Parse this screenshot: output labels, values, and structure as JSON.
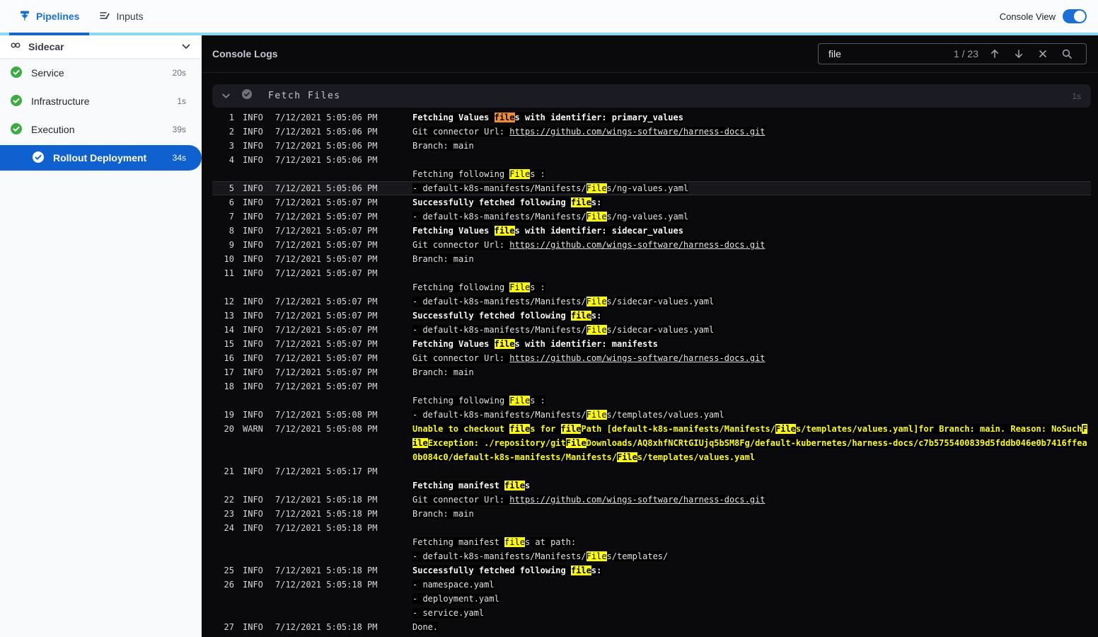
{
  "topbar": {
    "tabs": [
      {
        "label": "Pipelines"
      },
      {
        "label": "Inputs"
      }
    ],
    "console_view_label": "Console View",
    "console_view_on": true
  },
  "sidebar": {
    "title": "Sidecar",
    "items": [
      {
        "label": "Service",
        "duration": "20s",
        "status": "success"
      },
      {
        "label": "Infrastructure",
        "duration": "1s",
        "status": "success"
      },
      {
        "label": "Execution",
        "duration": "39s",
        "status": "success"
      },
      {
        "label": "Rollout Deployment",
        "duration": "34s",
        "status": "success",
        "selected": true
      }
    ]
  },
  "console": {
    "title": "Console Logs",
    "search": {
      "value": "file",
      "counter": "1 / 23"
    },
    "section": {
      "title": "Fetch Files",
      "duration": "1s"
    }
  },
  "colors": {
    "accent_blue": "#1A70D6",
    "selected_blue": "#0E61CE",
    "success_green": "#3BAB42",
    "match_current": "#F28D2D",
    "match_other": "#FCFC03",
    "warn_text": "#FCFC03",
    "console_bg": "#0A0A0D"
  },
  "logs": [
    {
      "num": 1,
      "level": "INFO",
      "time": "7/12/2021 5:05:06 PM",
      "bold": true,
      "lines": [
        [
          {
            "text": "Fetching Values "
          },
          {
            "text": "file",
            "mark": "o"
          },
          {
            "text": "s with identifier: primary_values"
          }
        ]
      ]
    },
    {
      "num": 2,
      "level": "INFO",
      "time": "7/12/2021 5:05:06 PM",
      "lines": [
        [
          {
            "text": "Git connector Url: "
          },
          {
            "text": "https://github.com/wings-software/harness-docs.git",
            "link": true
          }
        ]
      ]
    },
    {
      "num": 3,
      "level": "INFO",
      "time": "7/12/2021 5:05:06 PM",
      "lines": [
        [
          {
            "text": "Branch: main"
          }
        ]
      ]
    },
    {
      "num": 4,
      "level": "INFO",
      "time": "7/12/2021 5:05:06 PM",
      "lines": [
        [],
        [
          {
            "text": "Fetching following "
          },
          {
            "text": "File",
            "mark": "y"
          },
          {
            "text": "s :"
          }
        ]
      ]
    },
    {
      "num": 5,
      "level": "INFO",
      "time": "7/12/2021 5:05:06 PM",
      "selected": true,
      "lines": [
        [
          {
            "text": "- default-k8s-manifests/Manifests/"
          },
          {
            "text": "File",
            "mark": "y"
          },
          {
            "text": "s/ng-values.yaml"
          }
        ]
      ]
    },
    {
      "num": 6,
      "level": "INFO",
      "time": "7/12/2021 5:05:07 PM",
      "bold": true,
      "lines": [
        [
          {
            "text": "Successfully fetched following "
          },
          {
            "text": "file",
            "mark": "y"
          },
          {
            "text": "s:"
          }
        ]
      ]
    },
    {
      "num": 7,
      "level": "INFO",
      "time": "7/12/2021 5:05:07 PM",
      "lines": [
        [
          {
            "text": "- default-k8s-manifests/Manifests/"
          },
          {
            "text": "File",
            "mark": "y"
          },
          {
            "text": "s/ng-values.yaml"
          }
        ]
      ]
    },
    {
      "num": 8,
      "level": "INFO",
      "time": "7/12/2021 5:05:07 PM",
      "bold": true,
      "lines": [
        [
          {
            "text": "Fetching Values "
          },
          {
            "text": "file",
            "mark": "y"
          },
          {
            "text": "s with identifier: sidecar_values"
          }
        ]
      ]
    },
    {
      "num": 9,
      "level": "INFO",
      "time": "7/12/2021 5:05:07 PM",
      "lines": [
        [
          {
            "text": "Git connector Url: "
          },
          {
            "text": "https://github.com/wings-software/harness-docs.git",
            "link": true
          }
        ]
      ]
    },
    {
      "num": 10,
      "level": "INFO",
      "time": "7/12/2021 5:05:07 PM",
      "lines": [
        [
          {
            "text": "Branch: main"
          }
        ]
      ]
    },
    {
      "num": 11,
      "level": "INFO",
      "time": "7/12/2021 5:05:07 PM",
      "lines": [
        [],
        [
          {
            "text": "Fetching following "
          },
          {
            "text": "File",
            "mark": "y"
          },
          {
            "text": "s :"
          }
        ]
      ]
    },
    {
      "num": 12,
      "level": "INFO",
      "time": "7/12/2021 5:05:07 PM",
      "lines": [
        [
          {
            "text": "- default-k8s-manifests/Manifests/"
          },
          {
            "text": "File",
            "mark": "y"
          },
          {
            "text": "s/sidecar-values.yaml"
          }
        ]
      ]
    },
    {
      "num": 13,
      "level": "INFO",
      "time": "7/12/2021 5:05:07 PM",
      "bold": true,
      "lines": [
        [
          {
            "text": "Successfully fetched following "
          },
          {
            "text": "file",
            "mark": "y"
          },
          {
            "text": "s:"
          }
        ]
      ]
    },
    {
      "num": 14,
      "level": "INFO",
      "time": "7/12/2021 5:05:07 PM",
      "lines": [
        [
          {
            "text": "- default-k8s-manifests/Manifests/"
          },
          {
            "text": "File",
            "mark": "y"
          },
          {
            "text": "s/sidecar-values.yaml"
          }
        ]
      ]
    },
    {
      "num": 15,
      "level": "INFO",
      "time": "7/12/2021 5:05:07 PM",
      "bold": true,
      "lines": [
        [
          {
            "text": "Fetching Values "
          },
          {
            "text": "file",
            "mark": "y"
          },
          {
            "text": "s with identifier: manifests"
          }
        ]
      ]
    },
    {
      "num": 16,
      "level": "INFO",
      "time": "7/12/2021 5:05:07 PM",
      "lines": [
        [
          {
            "text": "Git connector Url: "
          },
          {
            "text": "https://github.com/wings-software/harness-docs.git",
            "link": true
          }
        ]
      ]
    },
    {
      "num": 17,
      "level": "INFO",
      "time": "7/12/2021 5:05:07 PM",
      "lines": [
        [
          {
            "text": "Branch: main"
          }
        ]
      ]
    },
    {
      "num": 18,
      "level": "INFO",
      "time": "7/12/2021 5:05:07 PM",
      "lines": [
        [],
        [
          {
            "text": "Fetching following "
          },
          {
            "text": "File",
            "mark": "y"
          },
          {
            "text": "s :"
          }
        ]
      ]
    },
    {
      "num": 19,
      "level": "INFO",
      "time": "7/12/2021 5:05:08 PM",
      "lines": [
        [
          {
            "text": "- default-k8s-manifests/Manifests/"
          },
          {
            "text": "File",
            "mark": "y"
          },
          {
            "text": "s/templates/values.yaml"
          }
        ]
      ]
    },
    {
      "num": 20,
      "level": "WARN",
      "time": "7/12/2021 5:05:08 PM",
      "warn": true,
      "lines": [
        [
          {
            "text": "Unable to checkout "
          },
          {
            "text": "file",
            "mark": "y"
          },
          {
            "text": "s for "
          },
          {
            "text": "file",
            "mark": "y"
          },
          {
            "text": "Path [default-k8s-manifests/Manifests/"
          },
          {
            "text": "File",
            "mark": "y"
          },
          {
            "text": "s/templates/values.yaml]for Branch: main. Reason: NoSuch"
          },
          {
            "text": "File",
            "mark": "y"
          },
          {
            "text": "Exception: ./repository/git"
          },
          {
            "text": "File",
            "mark": "y"
          },
          {
            "text": "Downloads/AQ8xhfNCRtGIUjq5bSM8Fg/default-kubernetes/harness-docs/c7b5755400839d5fddb046e0b7416ffea0b084c0/default-k8s-manifests/Manifests/"
          },
          {
            "text": "File",
            "mark": "y"
          },
          {
            "text": "s/templates/values.yaml"
          }
        ]
      ]
    },
    {
      "num": 21,
      "level": "INFO",
      "time": "7/12/2021 5:05:17 PM",
      "bold": true,
      "lines": [
        [],
        [
          {
            "text": "Fetching manifest "
          },
          {
            "text": "file",
            "mark": "y"
          },
          {
            "text": "s"
          }
        ]
      ]
    },
    {
      "num": 22,
      "level": "INFO",
      "time": "7/12/2021 5:05:18 PM",
      "lines": [
        [
          {
            "text": "Git connector Url: "
          },
          {
            "text": "https://github.com/wings-software/harness-docs.git",
            "link": true
          }
        ]
      ]
    },
    {
      "num": 23,
      "level": "INFO",
      "time": "7/12/2021 5:05:18 PM",
      "lines": [
        [
          {
            "text": "Branch: main"
          }
        ]
      ]
    },
    {
      "num": 24,
      "level": "INFO",
      "time": "7/12/2021 5:05:18 PM",
      "lines": [
        [],
        [
          {
            "text": "Fetching manifest "
          },
          {
            "text": "file",
            "mark": "y"
          },
          {
            "text": "s at path:"
          }
        ],
        [
          {
            "text": "- default-k8s-manifests/Manifests/"
          },
          {
            "text": "File",
            "mark": "y"
          },
          {
            "text": "s/templates/"
          }
        ]
      ]
    },
    {
      "num": 25,
      "level": "INFO",
      "time": "7/12/2021 5:05:18 PM",
      "bold": true,
      "lines": [
        [
          {
            "text": "Successfully fetched following "
          },
          {
            "text": "file",
            "mark": "y"
          },
          {
            "text": "s:"
          }
        ]
      ]
    },
    {
      "num": 26,
      "level": "INFO",
      "time": "7/12/2021 5:05:18 PM",
      "lines": [
        [
          {
            "text": "- namespace.yaml"
          }
        ],
        [
          {
            "text": "- deployment.yaml"
          }
        ],
        [
          {
            "text": "- service.yaml"
          }
        ]
      ]
    },
    {
      "num": 27,
      "level": "INFO",
      "time": "7/12/2021 5:05:18 PM",
      "lines": [
        [
          {
            "text": "Done."
          }
        ]
      ]
    }
  ]
}
